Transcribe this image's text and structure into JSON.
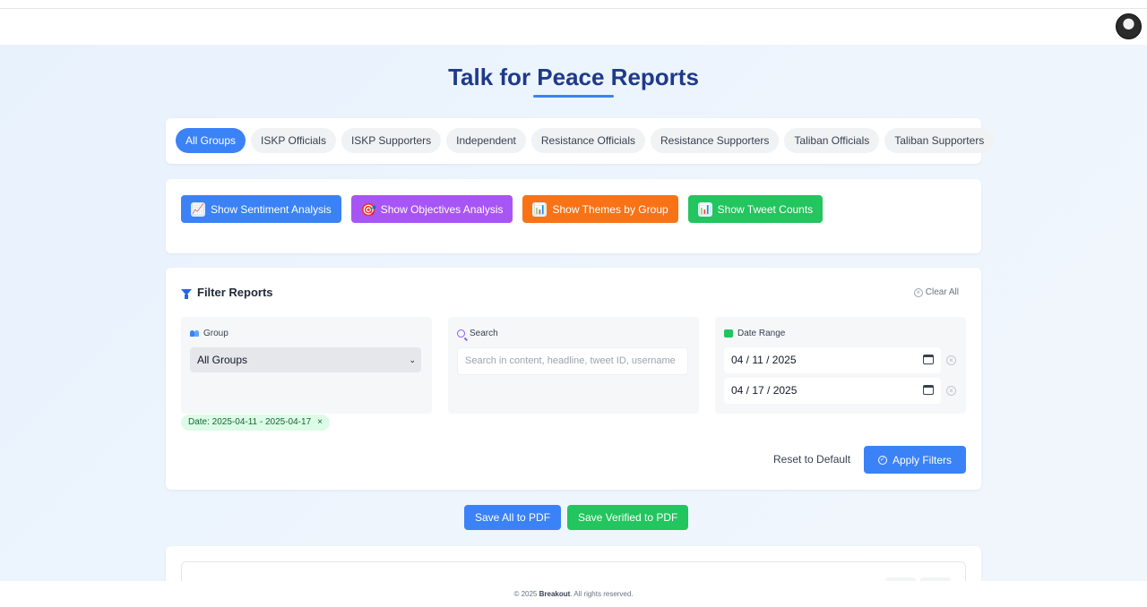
{
  "page": {
    "title": "Talk for Peace Reports"
  },
  "header": {
    "avatar_icon": "user-avatar"
  },
  "tabs": [
    {
      "label": "All Groups",
      "active": true
    },
    {
      "label": "ISKP Officials",
      "active": false
    },
    {
      "label": "ISKP Supporters",
      "active": false
    },
    {
      "label": "Independent",
      "active": false
    },
    {
      "label": "Resistance Officials",
      "active": false
    },
    {
      "label": "Resistance Supporters",
      "active": false
    },
    {
      "label": "Taliban Officials",
      "active": false
    },
    {
      "label": "Taliban Supporters",
      "active": false
    }
  ],
  "analysis_buttons": {
    "sentiment": {
      "label": "Show Sentiment Analysis",
      "icon": "chart-increasing-icon",
      "color": "#3b82f6"
    },
    "objectives": {
      "label": "Show Objectives Analysis",
      "icon": "target-icon",
      "color": "#a855f7"
    },
    "themes": {
      "label": "Show Themes by Group",
      "icon": "bar-chart-icon",
      "color": "#f97316"
    },
    "tweet_counts": {
      "label": "Show Tweet Counts",
      "icon": "bar-chart-icon",
      "color": "#22c55e"
    }
  },
  "filters": {
    "title": "Filter Reports",
    "clear_all": "Clear All",
    "group": {
      "label": "Group",
      "selected": "All Groups"
    },
    "search": {
      "label": "Search",
      "placeholder": "Search in content, headline, tweet ID, username"
    },
    "date_range": {
      "label": "Date Range",
      "start": "04 / 11 / 2025",
      "end": "04 / 17 / 2025"
    },
    "active_chip": "Date: 2025-04-11 - 2025-04-17",
    "chip_remove": "×",
    "reset_label": "Reset to Default",
    "apply_label": "Apply Filters"
  },
  "export": {
    "save_all": "Save All to PDF",
    "save_verified": "Save Verified to PDF"
  },
  "footer": {
    "prefix": "© 2025",
    "brand": "Breakout",
    "suffix": ". All rights reserved."
  },
  "colors": {
    "primary": "#3b82f6",
    "title": "#1e3a8a",
    "success": "#22c55e",
    "purple": "#a855f7",
    "orange": "#f97316"
  }
}
